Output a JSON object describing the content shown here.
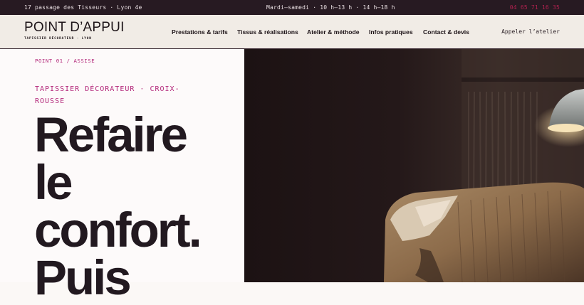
{
  "topbar": {
    "address": "17 passage des Tisseurs · Lyon 4e",
    "hours": "Mardi—samedi · 10 h—13 h · 14 h—18 h",
    "phone": "04 65 71 16 35"
  },
  "header": {
    "brand_name": "POINT D’APPUI",
    "brand_tagline": "TAPISSIER DÉCORATEUR · LYON",
    "nav": [
      "Prestations & tarifs",
      "Tissus & réalisations",
      "Atelier & méthode",
      "Infos pratiques",
      "Contact & devis"
    ],
    "call_label": "Appeler l’atelier"
  },
  "hero": {
    "breadcrumb": "POINT 01 / ASSISE",
    "kicker": "TAPISSIER DÉCORATEUR · CROIX-ROUSSE",
    "headline_lines": [
      "Refaire",
      "le",
      "confort.",
      "Puis"
    ]
  },
  "colors": {
    "topbar_bg": "#271a22",
    "accent": "#b3287a",
    "phone": "#b1214f",
    "header_bg": "#f1ece6"
  }
}
